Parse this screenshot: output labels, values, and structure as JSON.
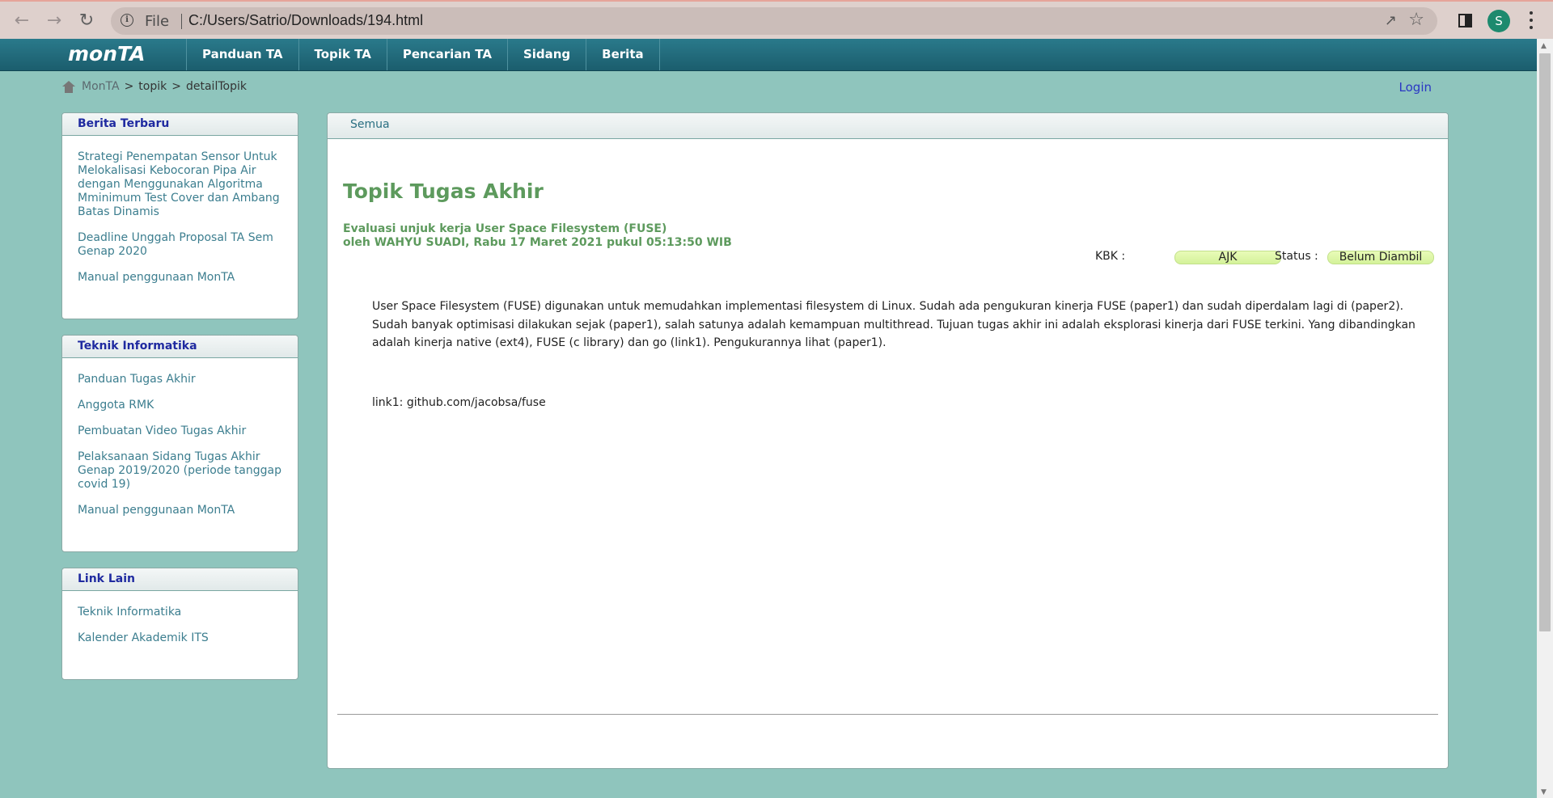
{
  "browser": {
    "scheme_label": "File",
    "url": "C:/Users/Satrio/Downloads/194.html",
    "profile_initial": "S",
    "icons": [
      "back-icon",
      "forward-icon",
      "reload-icon",
      "info-icon",
      "share-icon",
      "star-icon",
      "side-panel-icon",
      "menu-icon"
    ]
  },
  "site": {
    "logo": "monTA",
    "menu": [
      "Panduan TA",
      "Topik TA",
      "Pencarian TA",
      "Sidang",
      "Berita"
    ],
    "breadcrumb": {
      "home": "MonTA",
      "sep": ">",
      "crumbs": [
        "topik",
        "detailTopik"
      ]
    },
    "login": "Login"
  },
  "sidebar": {
    "berita": {
      "title": "Berita Terbaru",
      "items": [
        "Strategi Penempatan Sensor Untuk Melokalisasi Kebocoran Pipa Air dengan Menggunakan Algoritma Mminimum Test Cover dan Ambang Batas Dinamis",
        "Deadline Unggah Proposal TA Sem Genap 2020",
        "Manual penggunaan MonTA"
      ]
    },
    "teknik": {
      "title": "Teknik Informatika",
      "items": [
        "Panduan Tugas Akhir",
        "Anggota RMK",
        "Pembuatan Video Tugas Akhir",
        "Pelaksanaan Sidang Tugas Akhir Genap 2019/2020 (periode tanggap covid 19)",
        "Manual penggunaan MonTA"
      ]
    },
    "linklain": {
      "title": "Link Lain",
      "items": [
        "Teknik Informatika",
        "Kalender Akademik ITS"
      ]
    }
  },
  "main": {
    "tab": "Semua",
    "page_title": "Topik Tugas Akhir",
    "topic_title": "Evaluasi unjuk kerja User Space Filesystem (FUSE)",
    "topic_meta": "oleh WAHYU SUADI, Rabu 17 Maret 2021 pukul 05:13:50 WIB",
    "kbk_label": "KBK :",
    "kbk_value": "AJK",
    "status_label": "Status :",
    "status_value": "Belum Diambil",
    "description": "User Space Filesystem (FUSE) digunakan untuk memudahkan implementasi filesystem di Linux. Sudah ada pengukuran kinerja FUSE (paper1) dan sudah diperdalam lagi di (paper2). Sudah banyak optimisasi dilakukan sejak (paper1), salah satunya adalah kemampuan multithread. Tujuan tugas akhir ini adalah eksplorasi kinerja dari FUSE terkini. Yang dibandingkan adalah kinerja native (ext4), FUSE (c library) dan go (link1). Pengukurannya lihat (paper1).",
    "link1": "link1: github.com/jacobsa/fuse"
  }
}
